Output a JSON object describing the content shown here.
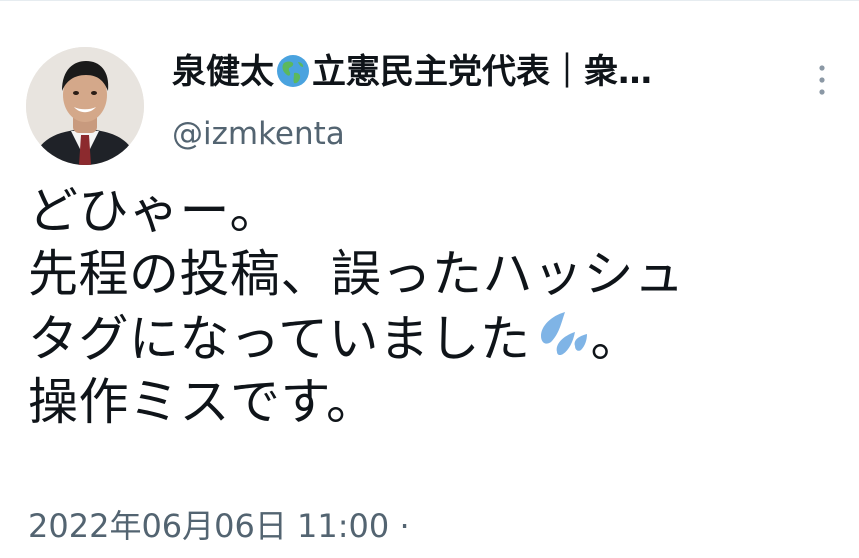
{
  "author": {
    "display_name_part1": "泉健太",
    "display_name_part2": "立憲民主党代表｜衆…",
    "handle": "@izmkenta",
    "badge_icon": "globe-americas-icon",
    "avatar": "profile-photo-avatar"
  },
  "tweet": {
    "line1": "どひゃー。",
    "line2": "先程の投稿、誤ったハッシュ",
    "line3_before": "タグになっていました",
    "line3_emoji": "sweat-droplets-icon",
    "line3_after": "。",
    "line4": "操作ミスです。"
  },
  "meta": {
    "timestamp": "2022年06月06日 11:00",
    "separator": "·"
  },
  "colors": {
    "text": "#0f1419",
    "secondary": "#536471",
    "drops": "#7fb4e6"
  },
  "menu": {
    "more_icon": "more-vertical-icon"
  }
}
